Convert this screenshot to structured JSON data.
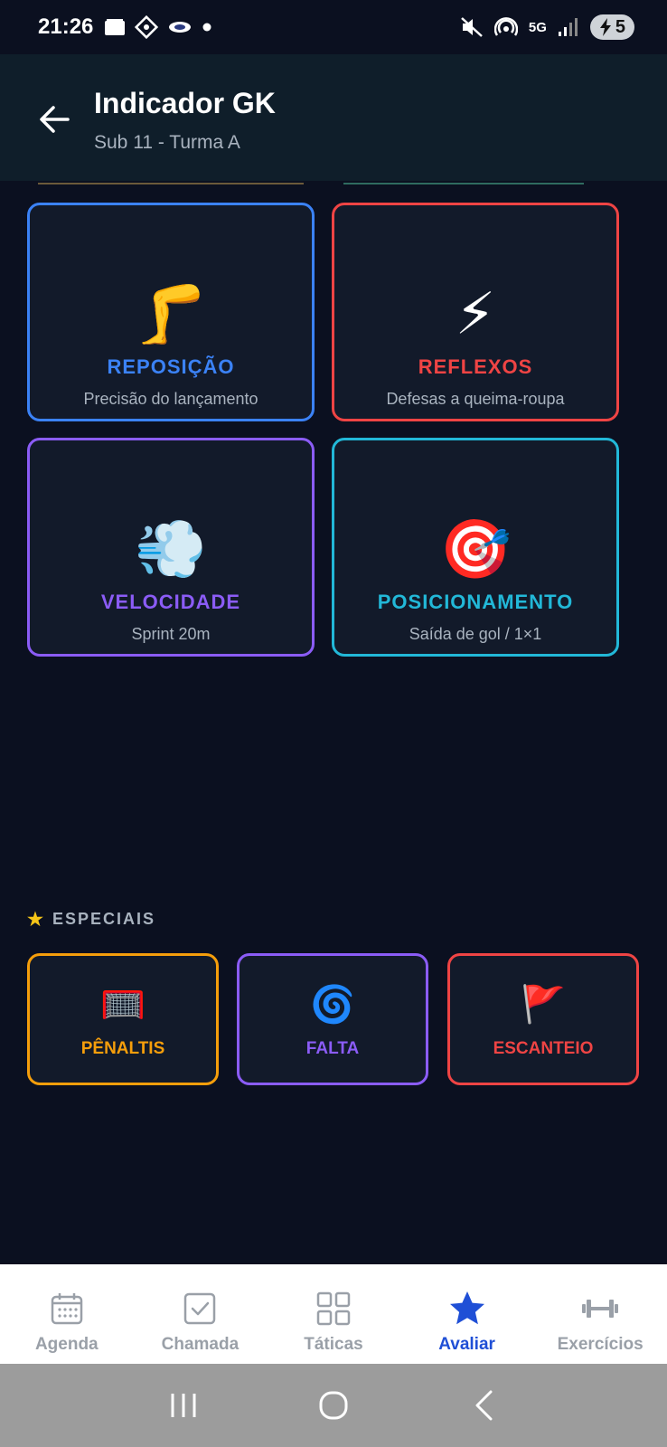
{
  "status_bar": {
    "time": "21:26",
    "battery_level": "5",
    "network": "5G"
  },
  "header": {
    "title": "Indicador GK",
    "subtitle": "Sub 11 - Turma A"
  },
  "categories": [
    {
      "title": "REPOSIÇÃO",
      "subtitle": "Precisão do lançamento",
      "icon": "leg-icon",
      "glyph": "🦵",
      "color": "#3b82f6"
    },
    {
      "title": "REFLEXOS",
      "subtitle": "Defesas a queima-roupa",
      "icon": "lightning-icon",
      "glyph": "⚡",
      "color": "#ef4444"
    },
    {
      "title": "VELOCIDADE",
      "subtitle": "Sprint 20m",
      "icon": "dash-icon",
      "glyph": "💨",
      "color": "#8b5cf6"
    },
    {
      "title": "POSICIONAMENTO",
      "subtitle": "Saída de gol / 1×1",
      "icon": "target-icon",
      "glyph": "🎯",
      "color": "#22b8d8"
    }
  ],
  "specials": {
    "title": "ESPECIAIS",
    "items": [
      {
        "label": "PÊNALTIS",
        "icon": "goal-net-icon",
        "glyph": "🥅",
        "color": "#f59e0b"
      },
      {
        "label": "FALTA",
        "icon": "cyclone-icon",
        "glyph": "🌀",
        "color": "#8b5cf6"
      },
      {
        "label": "ESCANTEIO",
        "icon": "flag-icon",
        "glyph": "🚩",
        "color": "#ef4444"
      }
    ]
  },
  "bottom_nav": [
    {
      "label": "Agenda",
      "icon": "calendar-icon"
    },
    {
      "label": "Chamada",
      "icon": "checkbox-icon"
    },
    {
      "label": "Táticas",
      "icon": "grid-icon"
    },
    {
      "label": "Avaliar",
      "icon": "star-icon",
      "active": true
    },
    {
      "label": "Exercícios",
      "icon": "dumbbell-icon"
    }
  ],
  "colors": {
    "background": "#0b1020",
    "header": "#0f1e2a",
    "accent": "#1f4fd6"
  }
}
